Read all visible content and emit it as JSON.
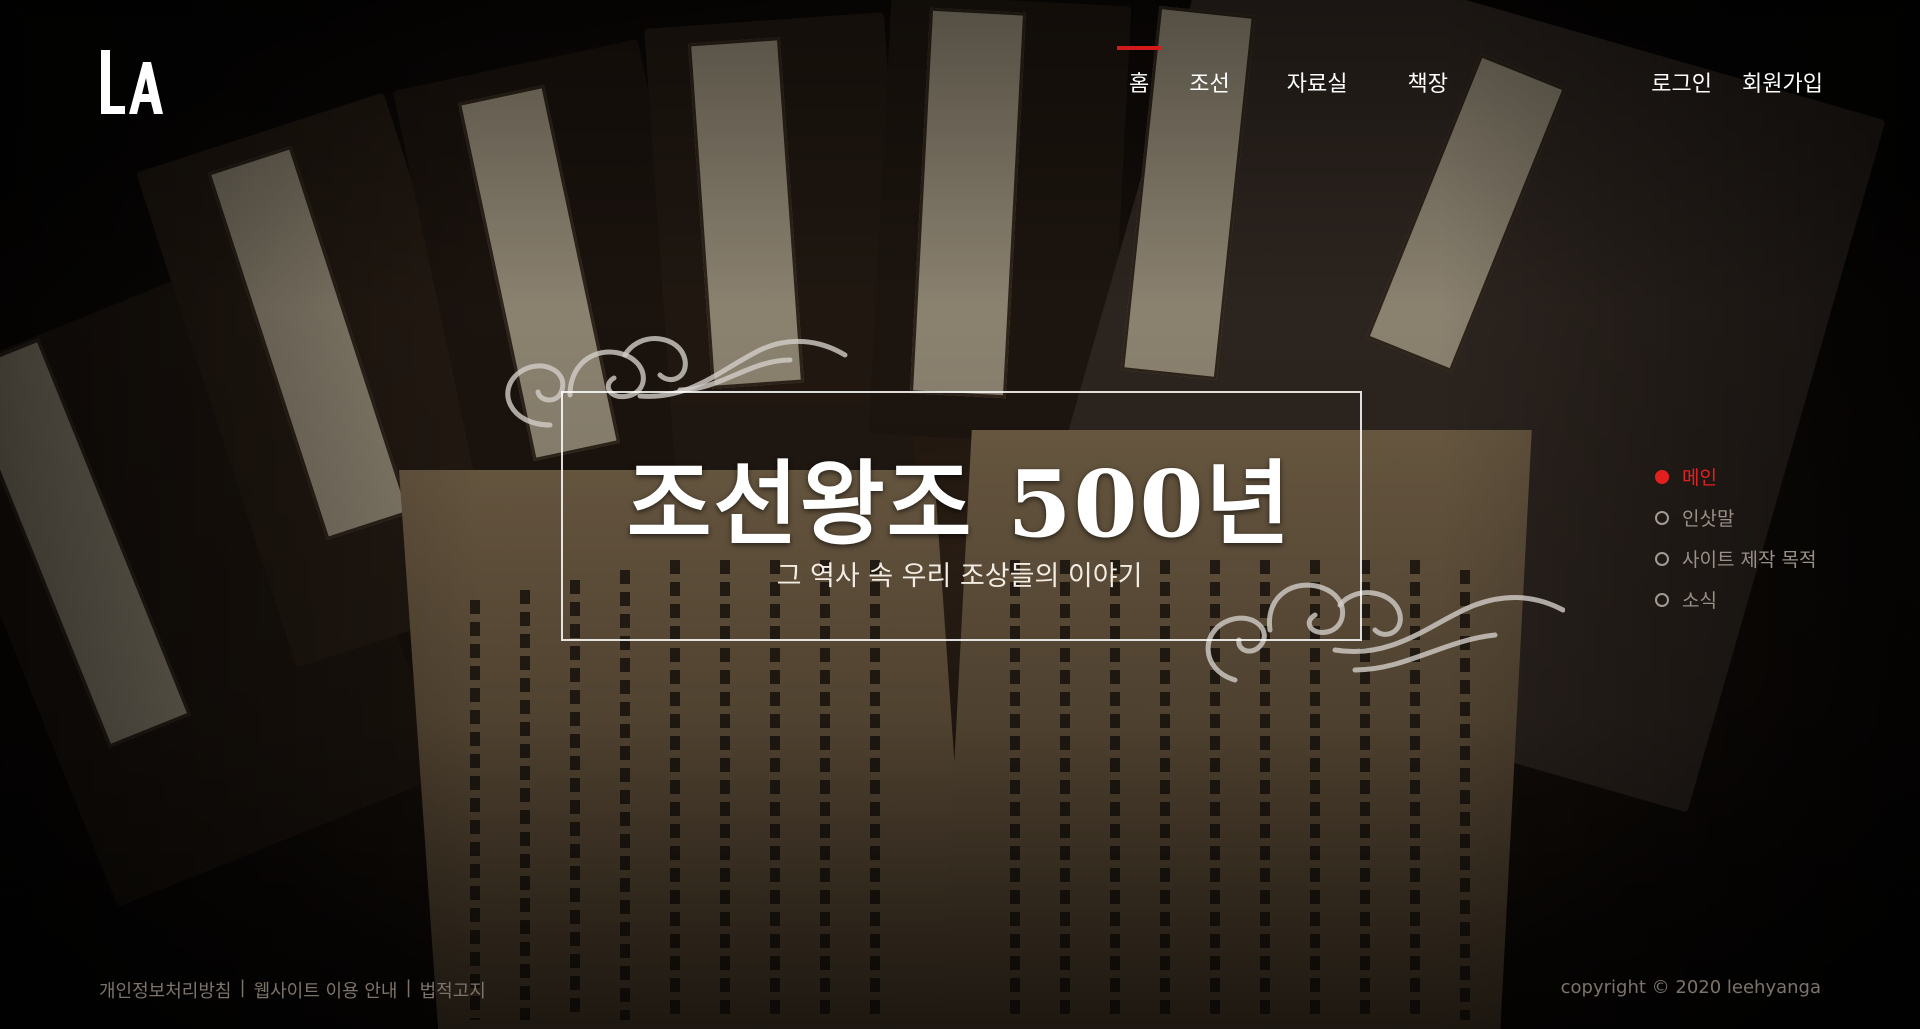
{
  "header": {
    "nav": [
      {
        "label": "홈",
        "active": true
      },
      {
        "label": "조선",
        "active": false
      },
      {
        "label": "자료실",
        "active": false
      },
      {
        "label": "책장",
        "active": false
      }
    ],
    "login_label": "로그인",
    "signup_label": "회원가입"
  },
  "hero": {
    "title": "조선왕조 500년",
    "subtitle": "그 역사 속 우리 조상들의 이야기"
  },
  "side_nav": [
    {
      "label": "메인",
      "active": true
    },
    {
      "label": "인삿말",
      "active": false
    },
    {
      "label": "사이트 제작 목적",
      "active": false
    },
    {
      "label": "소식",
      "active": false
    }
  ],
  "footer": {
    "links": [
      "개인정보처리방침",
      "웹사이트 이용 안내",
      "법적고지"
    ],
    "separator": "|",
    "copyright": "copyright © 2020 leehyanga"
  },
  "colors": {
    "accent": "#e32020",
    "footer_text": "#7c736b"
  }
}
